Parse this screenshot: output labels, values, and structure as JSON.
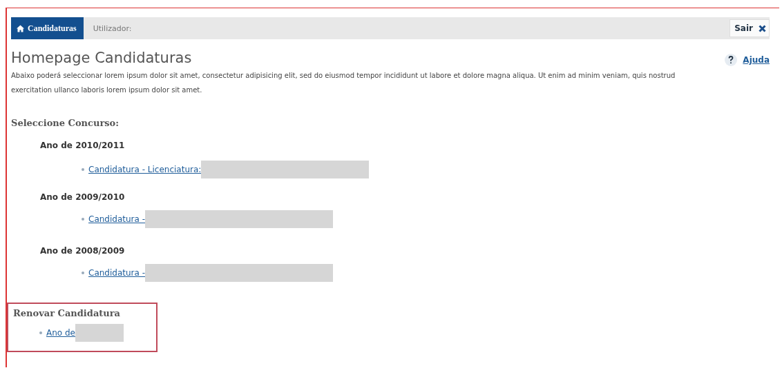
{
  "top_bar": {
    "home_tab": "Candidaturas",
    "user_label": "Utilizador:",
    "logout": "Sair"
  },
  "header": {
    "title": "Homepage Candidaturas",
    "help": "Ajuda",
    "description": "Abaixo poderá seleccionar lorem ipsum dolor sit amet, consectetur adipisicing elit, sed do eiusmod tempor incididunt ut labore et dolore magna aliqua. Ut enim ad minim veniam, quis nostrud exercitation ullanco laboris lorem ipsum dolor sit amet."
  },
  "contests": {
    "heading": "Seleccione Concurso:",
    "years": [
      {
        "year": "Ano de 2010/2011",
        "links": [
          {
            "label": "Candidatura - Licenciatura:",
            "redacted": true
          }
        ]
      },
      {
        "year": "Ano de 2009/2010",
        "links": [
          {
            "label": "Candidatura -",
            "redacted": true
          }
        ]
      },
      {
        "year": "Ano de 2008/2009",
        "links": [
          {
            "label": "Candidatura -",
            "redacted": true
          }
        ]
      }
    ]
  },
  "renew": {
    "heading": "Renovar Candidatura",
    "links": [
      {
        "label": "Ano de",
        "redacted": true
      }
    ]
  }
}
